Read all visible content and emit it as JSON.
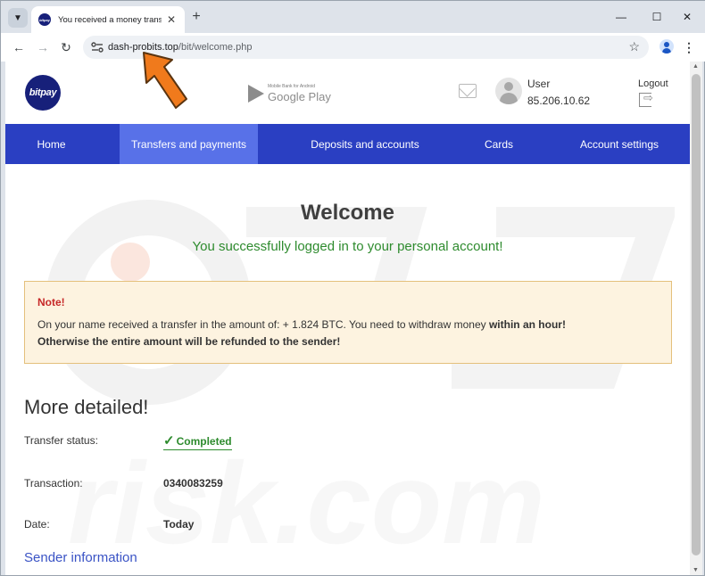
{
  "browser": {
    "tab_title": "You received a money transfer",
    "tab_favicon_text": "bitpay",
    "url_domain": "dash-probits.top",
    "url_path": "/bit/welcome.php",
    "icons": [
      "tab-list-icon",
      "close-icon",
      "new-tab-icon",
      "minimize-icon",
      "maximize-icon",
      "window-close-icon",
      "back-icon",
      "forward-icon",
      "reload-icon",
      "site-info-icon",
      "bookmark-star-icon",
      "profile-icon",
      "menu-icon"
    ]
  },
  "site": {
    "logo_text": "bitpay",
    "google_play_small": "Mobile Bank for Android",
    "google_play_big": "Google Play",
    "user_label": "User",
    "user_ip": "85.206.10.62",
    "logout_label": "Logout",
    "colors": {
      "nav_bg": "#2a3fc2",
      "nav_active": "#5871e8",
      "logo_bg": "#17207a",
      "success": "#2e8b2e",
      "note_title": "#c62828",
      "link": "#3a53c5",
      "annotation_arrow": "#f07a1c"
    }
  },
  "nav": {
    "items": [
      {
        "label": "Home",
        "active": false
      },
      {
        "label": "Transfers and payments",
        "active": true
      },
      {
        "label": "Deposits and accounts",
        "active": false
      },
      {
        "label": "Cards",
        "active": false
      },
      {
        "label": "Account settings",
        "active": false
      }
    ]
  },
  "main": {
    "welcome": "Welcome",
    "success": "You successfully logged in to your personal account!",
    "note": {
      "title": "Note!",
      "line1_prefix": "On your name received a transfer in the amount of: + 1.824 BTC. You need to withdraw money ",
      "line1_bold": "within an hour!",
      "line2": "Otherwise the entire amount will be refunded to the sender!"
    },
    "more_title": "More detailed!",
    "rows": [
      {
        "label": "Transfer status:",
        "value": "Completed"
      },
      {
        "label": "Transaction:",
        "value": "0340083259"
      },
      {
        "label": "Date:",
        "value": "Today"
      }
    ],
    "sender_link": "Sender information"
  }
}
